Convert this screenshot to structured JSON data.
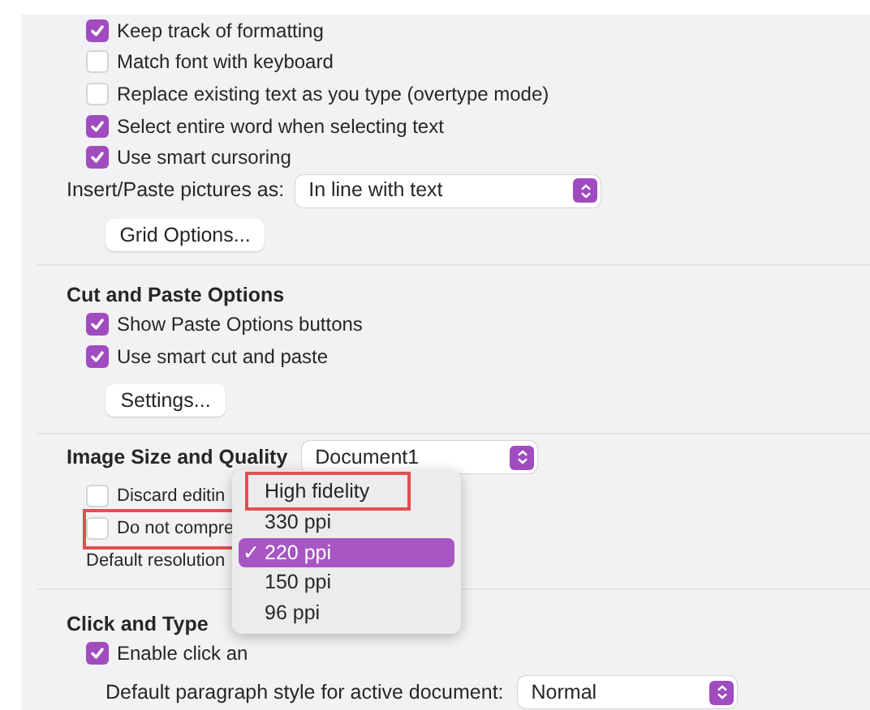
{
  "editing_options": [
    {
      "label": "Keep track of formatting",
      "checked": true
    },
    {
      "label": "Match font with keyboard",
      "checked": false
    },
    {
      "label": "Replace existing text as you type (overtype mode)",
      "checked": false
    },
    {
      "label": "Select entire word when selecting text",
      "checked": true
    },
    {
      "label": "Use smart cursoring",
      "checked": true
    }
  ],
  "insert_paste": {
    "label": "Insert/Paste pictures as:",
    "value": "In line with text"
  },
  "grid_button": "Grid Options...",
  "cut_paste": {
    "title": "Cut and Paste Options",
    "options": [
      {
        "label": "Show Paste Options buttons",
        "checked": true
      },
      {
        "label": "Use smart cut and paste",
        "checked": true
      }
    ],
    "button": "Settings..."
  },
  "image_quality": {
    "title": "Image Size and Quality",
    "document": "Document1",
    "options": [
      {
        "label": "Discard editin",
        "checked": false,
        "highlighted": false
      },
      {
        "label": "Do not compre",
        "checked": false,
        "highlighted": true
      }
    ],
    "resolution_label": "Default resolution"
  },
  "resolution_menu": [
    {
      "label": "High fidelity",
      "selected": false,
      "highlighted": true
    },
    {
      "label": "330 ppi",
      "selected": false,
      "highlighted": false
    },
    {
      "label": "220 ppi",
      "selected": true,
      "highlighted": false
    },
    {
      "label": "150 ppi",
      "selected": false,
      "highlighted": false
    },
    {
      "label": "96 ppi",
      "selected": false,
      "highlighted": false
    }
  ],
  "check_mark": "✓",
  "click_type": {
    "title": "Click and Type",
    "option": {
      "label": "Enable click an",
      "checked": true
    },
    "style_label": "Default paragraph style for active document:",
    "style_value": "Normal"
  }
}
